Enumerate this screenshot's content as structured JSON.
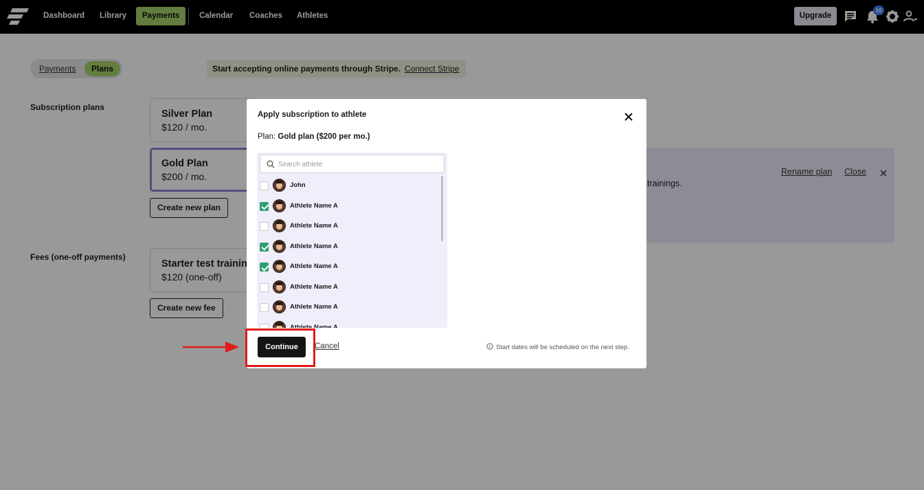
{
  "nav": {
    "items": [
      "Dashboard",
      "Library",
      "Payments",
      "Calendar",
      "Coaches",
      "Athletes"
    ],
    "active": "Payments",
    "upgrade_label": "Upgrade",
    "notification_count": "10",
    "icons": [
      "logo-icon",
      "chat-icon",
      "bell-icon",
      "gear-icon",
      "user-icon"
    ]
  },
  "toggle": {
    "payments_label": "Payments",
    "plans_label": "Plans"
  },
  "stripe_banner": {
    "text": "Start accepting online payments through Stripe.",
    "link": "Connect Stripe"
  },
  "subscription": {
    "label": "Subscription plans",
    "plans": [
      {
        "name": "Silver Plan",
        "price": "$120 / mo."
      },
      {
        "name": "Gold Plan",
        "price": "$200 / mo."
      }
    ],
    "create_label": "Create new plan"
  },
  "fees": {
    "label": "Fees (one-off payments)",
    "items": [
      {
        "name": "Starter test training",
        "price": "$120 (one-off)"
      }
    ],
    "create_label": "Create new fee"
  },
  "detail_panel": {
    "text": "trainings.",
    "rename_label": "Rename plan",
    "close_label": "Close"
  },
  "modal": {
    "title": "Apply subscription to athlete",
    "plan_prefix": "Plan:",
    "plan_value": "Gold plan ($200 per mo.)",
    "search_placeholder": "Search athlete",
    "athletes": [
      {
        "name": "John",
        "checked": false
      },
      {
        "name": "Athlete Name A",
        "checked": true
      },
      {
        "name": "Athlete Name A",
        "checked": false
      },
      {
        "name": "Athlete Name A",
        "checked": true
      },
      {
        "name": "Athlete Name A",
        "checked": true
      },
      {
        "name": "Athlete Name A",
        "checked": false
      },
      {
        "name": "Athlete Name A",
        "checked": false
      },
      {
        "name": "Athlete Name A",
        "checked": false
      }
    ],
    "continue_label": "Continue",
    "cancel_label": "Cancel",
    "hint": "Start dates will be scheduled on the next step."
  },
  "colors": {
    "accent_green": "#a6d16a",
    "check_green": "#2f9e6e",
    "selection_purple": "#8d7fd4",
    "annotation_red": "#e01b1b"
  }
}
